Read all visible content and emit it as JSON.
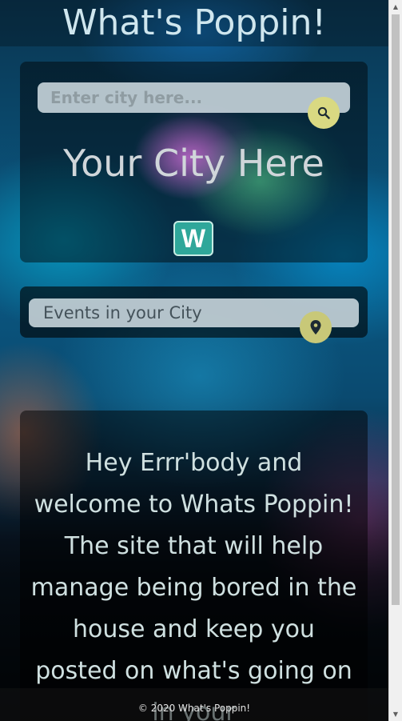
{
  "header": {
    "title": "What's Poppin!"
  },
  "search": {
    "placeholder": "Enter city here...",
    "button_icon": "search-icon"
  },
  "city": {
    "name": "Your City Here",
    "weather_button_label": "W"
  },
  "events": {
    "placeholder": "Events in your City",
    "button_icon": "map-marker-icon"
  },
  "welcome": {
    "text": "Hey Errr'body and welcome to Whats Poppin! The site that will help manage being bored in the house and keep you posted on what's going on in your"
  },
  "footer": {
    "text": "© 2020 What's Poppin!"
  },
  "colors": {
    "button_accent": "#d9d982",
    "weather_button": "#2fa79a",
    "title_text": "#cfe6ee"
  }
}
